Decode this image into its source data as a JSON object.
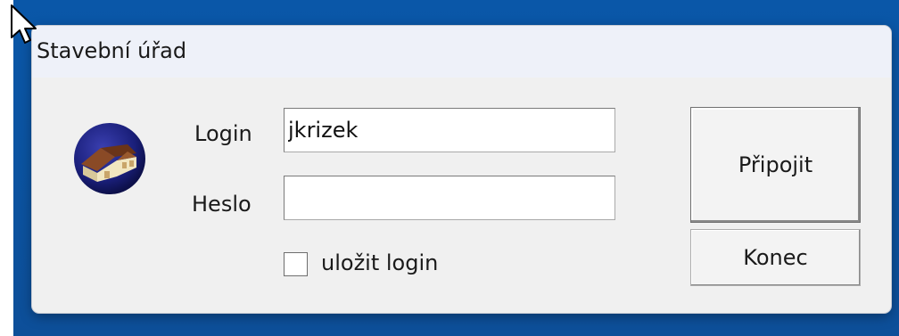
{
  "window": {
    "title": "Stavební úřad"
  },
  "form": {
    "login_label": "Login",
    "login_value": "jkrizek",
    "password_label": "Heslo",
    "password_value": "",
    "remember_label": "uložit login",
    "remember_checked": false
  },
  "buttons": {
    "connect_label": "Připojit",
    "quit_label": "Konec"
  },
  "icons": {
    "app": "house-globe-icon",
    "cursor": "mouse-pointer-icon"
  },
  "colors": {
    "desktop": "#0a57a8",
    "window_bg": "#f0f0f0",
    "titlebar_bg": "#eef1f9"
  }
}
